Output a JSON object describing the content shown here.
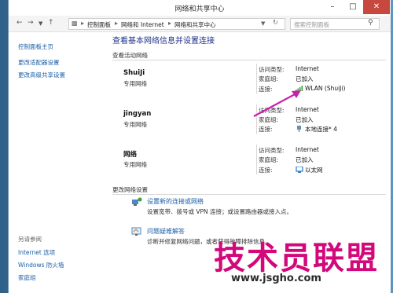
{
  "window": {
    "title": "网络和共享中心"
  },
  "address": {
    "crumbs": [
      "控制面板",
      "网络和 Internet",
      "网络和共享中心"
    ],
    "search_placeholder": "搜索控制面板"
  },
  "sidebar": {
    "items": [
      "控制面板主页",
      "更改适配器设置",
      "更改高级共享设置"
    ],
    "see_also_title": "另请参阅",
    "see_also": [
      "Internet 选项",
      "Windows 防火墙",
      "家庭组"
    ]
  },
  "main": {
    "heading": "查看基本网络信息并设置连接",
    "active_title": "查看活动网络",
    "labels": {
      "access": "访问类型:",
      "homegroup": "家庭组:",
      "connection": "连接:"
    },
    "networks": [
      {
        "name": "ShuiJi",
        "type": "专用网络",
        "access": "Internet",
        "homegroup": "已加入",
        "connection": "WLAN (ShuiJi)",
        "conn_icon": "wifi-signal-icon"
      },
      {
        "name": "jingyan",
        "type": "专用网络",
        "access": "Internet",
        "homegroup": "已加入",
        "connection": "本地连接* 4",
        "conn_icon": "network-adapter-icon"
      },
      {
        "name": "网络",
        "type": "专用网络",
        "access": "Internet",
        "homegroup": "已加入",
        "connection": "以太网",
        "conn_icon": "ethernet-icon"
      }
    ],
    "change_title": "更改网络设置",
    "settings": [
      {
        "title": "设置新的连接或网络",
        "desc": "设置宽带、拨号或 VPN 连接；或设置路由器或接入点。",
        "icon": "new-connection-icon"
      },
      {
        "title": "问题疑难解答",
        "desc": "诊断并修复网络问题，或者获得故障排除信息。",
        "icon": "troubleshoot-icon"
      }
    ]
  },
  "watermark": {
    "text": "技术员联盟",
    "url": "www.jsgho.com"
  },
  "colors": {
    "link": "#1a5ea6",
    "heading": "#1e3287",
    "arrow": "#c81fae",
    "watermark": "#d2087b",
    "close": "#c7483f"
  }
}
